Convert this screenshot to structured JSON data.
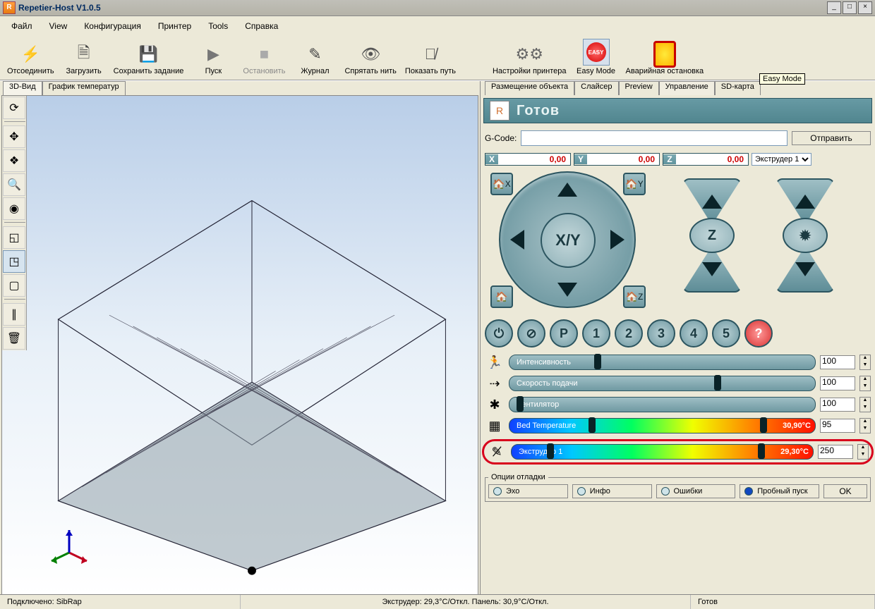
{
  "window": {
    "title": "Repetier-Host V1.0.5"
  },
  "menu": [
    "Файл",
    "View",
    "Конфигурация",
    "Принтер",
    "Tools",
    "Справка"
  ],
  "toolbar": [
    {
      "id": "disconnect",
      "label": "Отсоединить"
    },
    {
      "id": "load",
      "label": "Загрузить"
    },
    {
      "id": "save-job",
      "label": "Сохранить задание"
    },
    {
      "id": "run",
      "label": "Пуск"
    },
    {
      "id": "stop",
      "label": "Остановить"
    },
    {
      "id": "log",
      "label": "Журнал"
    },
    {
      "id": "hide-filament",
      "label": "Спрятать нить"
    },
    {
      "id": "show-path",
      "label": "Показать путь"
    },
    {
      "id": "printer-settings",
      "label": "Настройки принтера"
    },
    {
      "id": "easy-mode",
      "label": "Easy Mode"
    },
    {
      "id": "emergency",
      "label": "Аварийная остановка"
    }
  ],
  "easy_badge": "EASY",
  "tooltip": "Easy Mode",
  "left_tabs": [
    "3D-Вид",
    "График температур"
  ],
  "right_tabs": [
    "Размещение объекта",
    "Слайсер",
    "Preview",
    "Управление",
    "SD-карта"
  ],
  "status_header": "Готов",
  "gcode": {
    "label": "G-Code:",
    "placeholder": "",
    "send": "Отправить"
  },
  "coords": {
    "X": "0,00",
    "Y": "0,00",
    "Z": "0,00"
  },
  "extruder_select": "Экструдер 1",
  "dial": {
    "xy": "X/Y",
    "z": "Z"
  },
  "home": {
    "x": "X",
    "y": "Y",
    "z": "Z"
  },
  "cmd_buttons": [
    "⏻",
    "⊘",
    "P",
    "1",
    "2",
    "3",
    "4",
    "5",
    "?"
  ],
  "sliders": {
    "speed": {
      "label": "Интенсивность",
      "value": "100"
    },
    "feed": {
      "label": "Скорость подачи",
      "value": "100"
    },
    "fan": {
      "label": "Вентилятор",
      "value": "100"
    },
    "bed": {
      "label": "Bed Temperature",
      "temp": "30,90°C",
      "value": "95"
    },
    "ext": {
      "label": "Экструдер 1",
      "temp": "29,30°C",
      "value": "250"
    }
  },
  "debug": {
    "legend": "Опции отладки",
    "items": [
      "Эхо",
      "Инфо",
      "Ошибки",
      "Пробный пуск"
    ],
    "ok": "OK"
  },
  "statusbar": {
    "conn": "Подключено: SibRap",
    "temps": "Экструдер: 29,3°C/Откл. Панель: 30,9°C/Откл.",
    "ready": "Готов"
  }
}
